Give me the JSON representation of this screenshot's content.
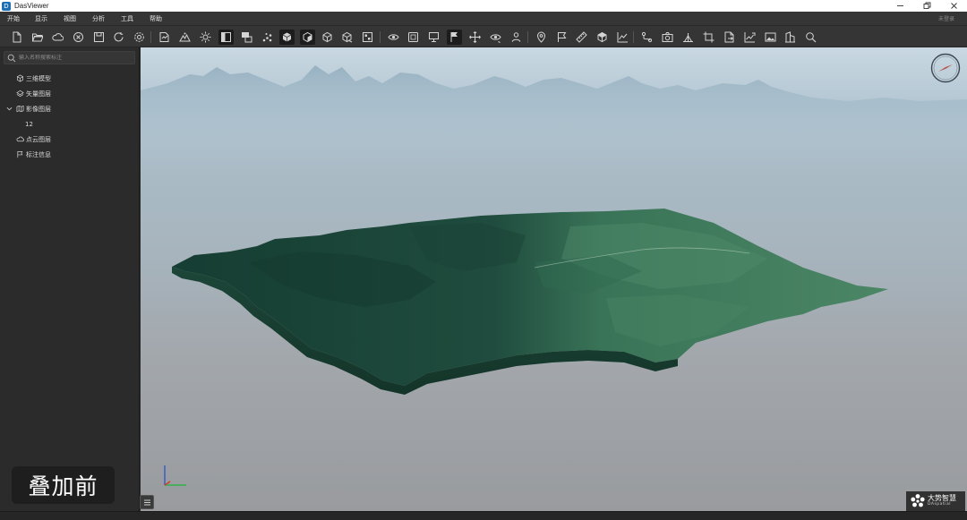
{
  "window": {
    "title": "DasViewer",
    "logo_text": "D"
  },
  "menu": {
    "items": [
      "开始",
      "显示",
      "视图",
      "分析",
      "工具",
      "帮助"
    ],
    "login": "未登录"
  },
  "toolbar": {
    "buttons": [
      "new-file-icon",
      "open-folder-icon",
      "cloud-icon",
      "close-circle-icon",
      "save-icon",
      "refresh-icon",
      "settings-icon",
      "import-icon",
      "terrain-icon",
      "light-icon",
      "panel-icon",
      "layers-toggle-icon",
      "point-cloud-icon",
      "box-solid-icon",
      "box-shaded-icon",
      "box-wire-icon",
      "box-clip-icon",
      "grid-icon",
      "eye-icon",
      "fullscreen-icon",
      "monitor-icon",
      "flag-pin-icon",
      "move-icon",
      "eye-rotate-icon",
      "fly-icon",
      "location-pin-icon",
      "flag-icon",
      "ruler-icon",
      "volume-icon",
      "profile-chart-icon",
      "path-icon",
      "camera-icon",
      "slope-icon",
      "crop-icon",
      "export-doc-icon",
      "chart-export-icon",
      "image-icon",
      "building-icon",
      "magnify-icon"
    ]
  },
  "sidebar": {
    "search_placeholder": "输入名称搜索标注",
    "items": [
      {
        "label": "三维模型",
        "icon": "cube-icon"
      },
      {
        "label": "矢量图层",
        "icon": "vector-layer-icon"
      },
      {
        "label": "影像图层",
        "icon": "image-layer-icon"
      },
      {
        "label": "12",
        "icon": ""
      },
      {
        "label": "点云图层",
        "icon": "point-cloud-layer-icon"
      },
      {
        "label": "标注信息",
        "icon": "annotation-flag-icon"
      }
    ]
  },
  "viewport": {
    "caption": "叠加前"
  },
  "brand": {
    "name": "大势智慧",
    "sub": "DAspatial"
  },
  "colors": {
    "accent": "#1f6fb5",
    "terrain_dark": "#1d4a3c",
    "terrain_light": "#3f7a5e",
    "compass_red": "#d23a2a"
  }
}
